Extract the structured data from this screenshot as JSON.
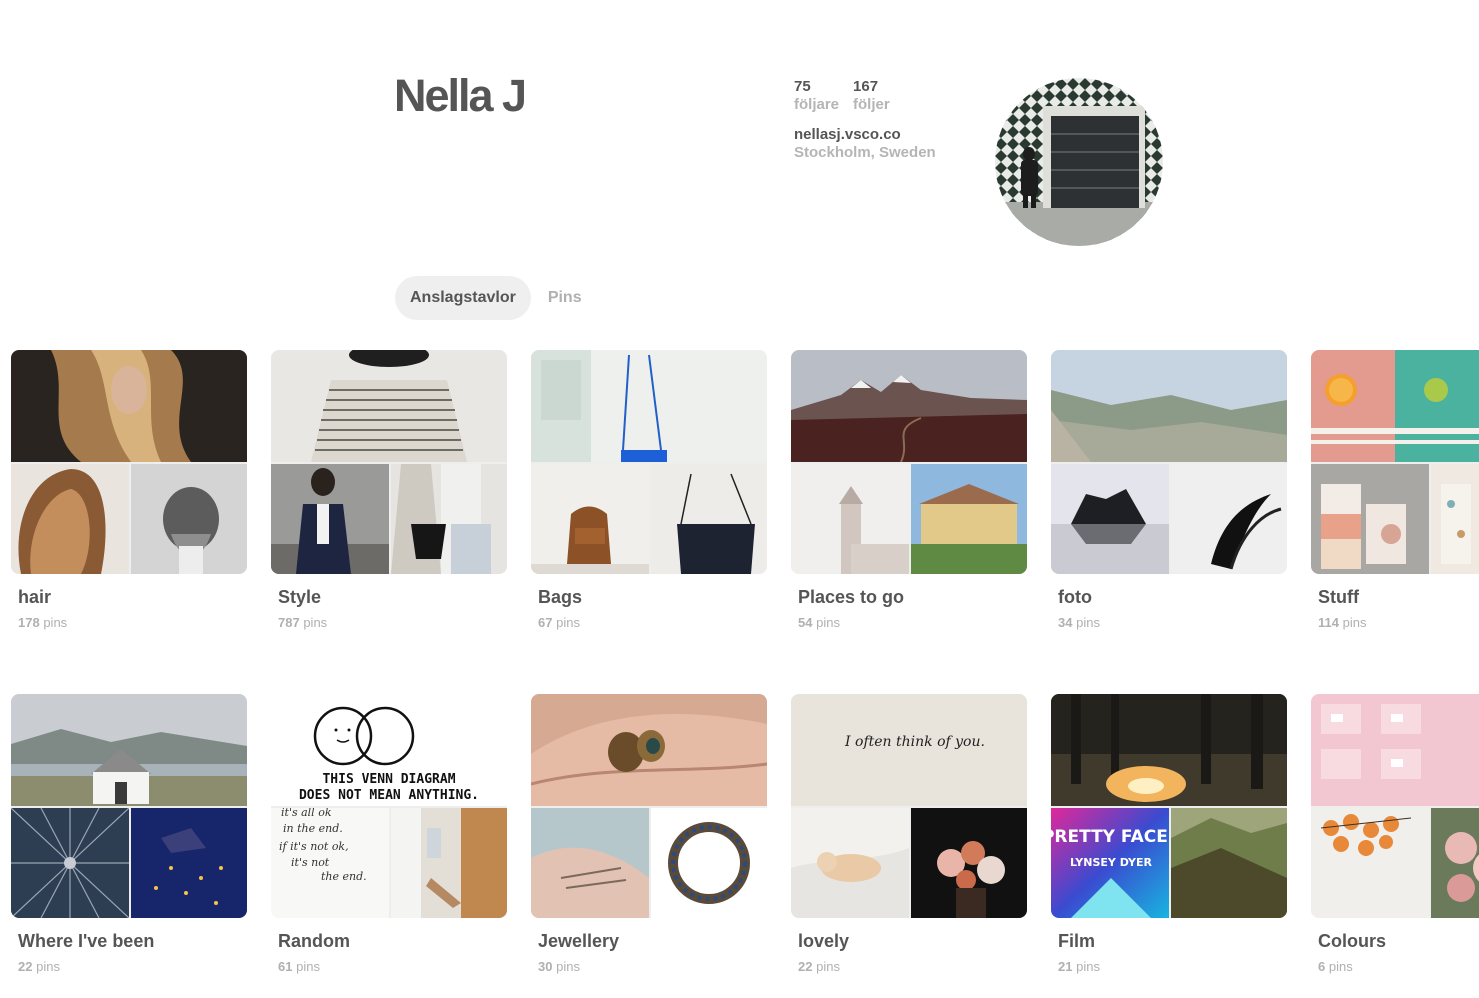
{
  "profile": {
    "name": "Nella J",
    "followers_count": "75",
    "followers_label": "följare",
    "following_count": "167",
    "following_label": "följer",
    "website": "nellasj.vsco.co",
    "location": "Stockholm, Sweden"
  },
  "tabs": [
    {
      "label": "Anslagstavlor",
      "active": true
    },
    {
      "label": "Pins",
      "active": false
    }
  ],
  "pins_suffix": "pins",
  "boards": [
    {
      "title": "hair",
      "count": "178"
    },
    {
      "title": "Style",
      "count": "787"
    },
    {
      "title": "Bags",
      "count": "67"
    },
    {
      "title": "Places to go",
      "count": "54"
    },
    {
      "title": "foto",
      "count": "34"
    },
    {
      "title": "Stuff",
      "count": "114"
    },
    {
      "title": "Where I've been",
      "count": "22"
    },
    {
      "title": "Random",
      "count": "61"
    },
    {
      "title": "Jewellery",
      "count": "30"
    },
    {
      "title": "lovely",
      "count": "22"
    },
    {
      "title": "Film",
      "count": "21"
    },
    {
      "title": "Colours",
      "count": "6"
    }
  ],
  "image_text": {
    "venn": "THIS VENN DIAGRAM DOES NOT MEAN ANYTHING.",
    "note": "it's all ok in the end. if it's not ok, it's not the end.",
    "lovely": "I often think of you.",
    "film_1": "PRETTY FACES",
    "film_2": "LYNSEY DYER"
  }
}
